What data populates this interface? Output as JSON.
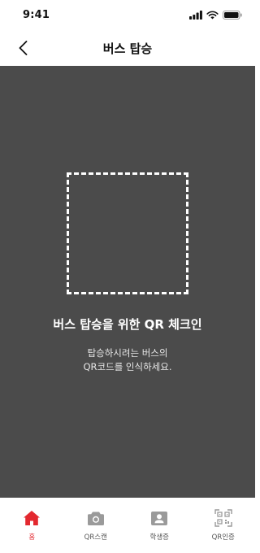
{
  "status_bar": {
    "time": "9:41"
  },
  "header": {
    "title": "버스 탑승"
  },
  "scanner": {
    "title": "버스 탑승을 위한 QR 체크인",
    "description_line1": "탑승하시려는 버스의",
    "description_line2": "QR코드를 인식하세요."
  },
  "tab_bar": {
    "tabs": [
      {
        "label": "홈",
        "icon": "home-icon",
        "active": true
      },
      {
        "label": "QR스캔",
        "icon": "camera-icon",
        "active": false
      },
      {
        "label": "학생증",
        "icon": "id-card-icon",
        "active": false
      },
      {
        "label": "QR인증",
        "icon": "qr-code-icon",
        "active": false
      }
    ]
  },
  "colors": {
    "accent": "#e3282f",
    "scanner_background": "#4b4b4b",
    "inactive_icon": "#9a9a9a"
  }
}
